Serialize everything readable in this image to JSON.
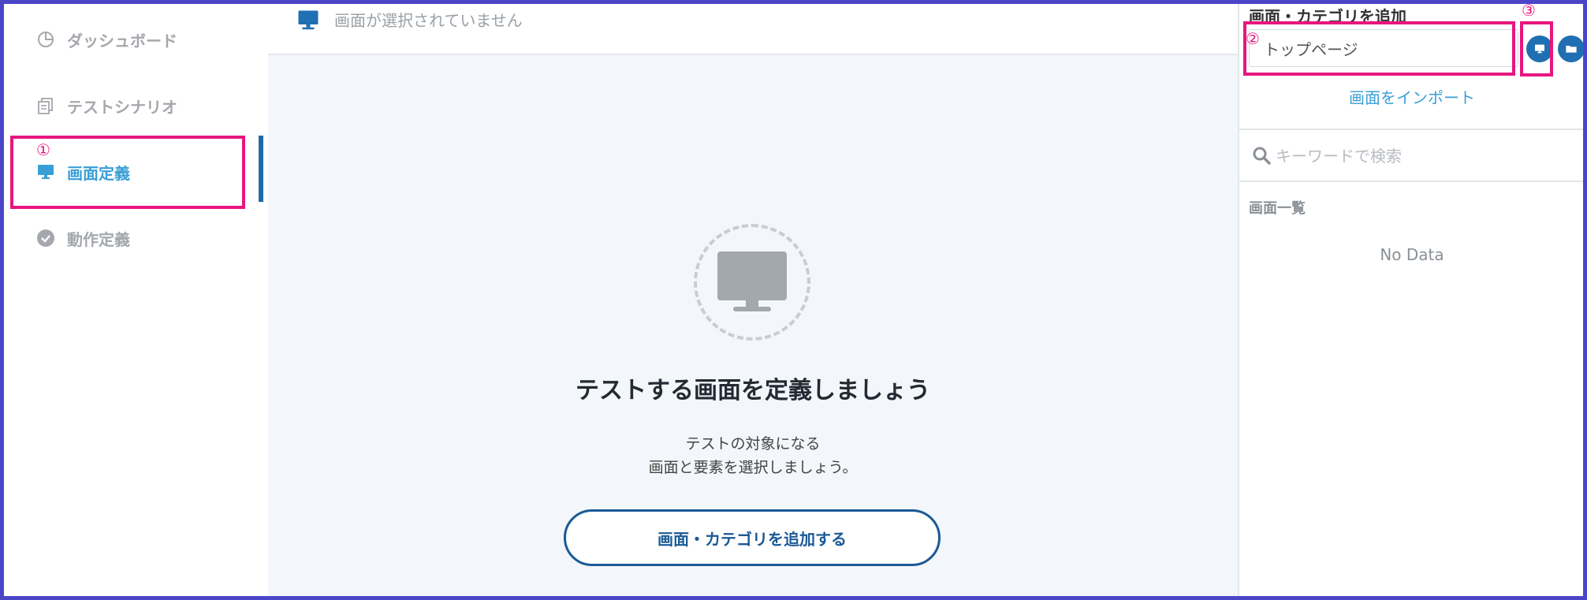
{
  "sidebar": {
    "items": [
      {
        "label": "ダッシュボード",
        "icon": "pie-chart-icon"
      },
      {
        "label": "テストシナリオ",
        "icon": "document-copy-icon"
      },
      {
        "label": "画面定義",
        "icon": "monitor-icon"
      },
      {
        "label": "動作定義",
        "icon": "check-circle-icon"
      }
    ],
    "active_index": 2
  },
  "header": {
    "status_text": "画面が選択されていません"
  },
  "main": {
    "empty_title": "テストする画面を定義しましょう",
    "empty_desc_line1": "テストの対象になる",
    "empty_desc_line2": "画面と要素を選択しましょう。",
    "add_button_label": "画面・カテゴリを追加する"
  },
  "right_panel": {
    "title": "画面・カテゴリを追加",
    "name_input_value": "トップページ",
    "import_link": "画面をインポート",
    "search_placeholder": "キーワードで検索",
    "list_title": "画面一覧",
    "empty_text": "No Data"
  },
  "annotations": [
    "①",
    "②",
    "③"
  ],
  "colors": {
    "accent": "#3a9fd6",
    "primary_dark": "#1a5a95",
    "annotation": "#e8167f",
    "frame": "#4b46c8"
  }
}
